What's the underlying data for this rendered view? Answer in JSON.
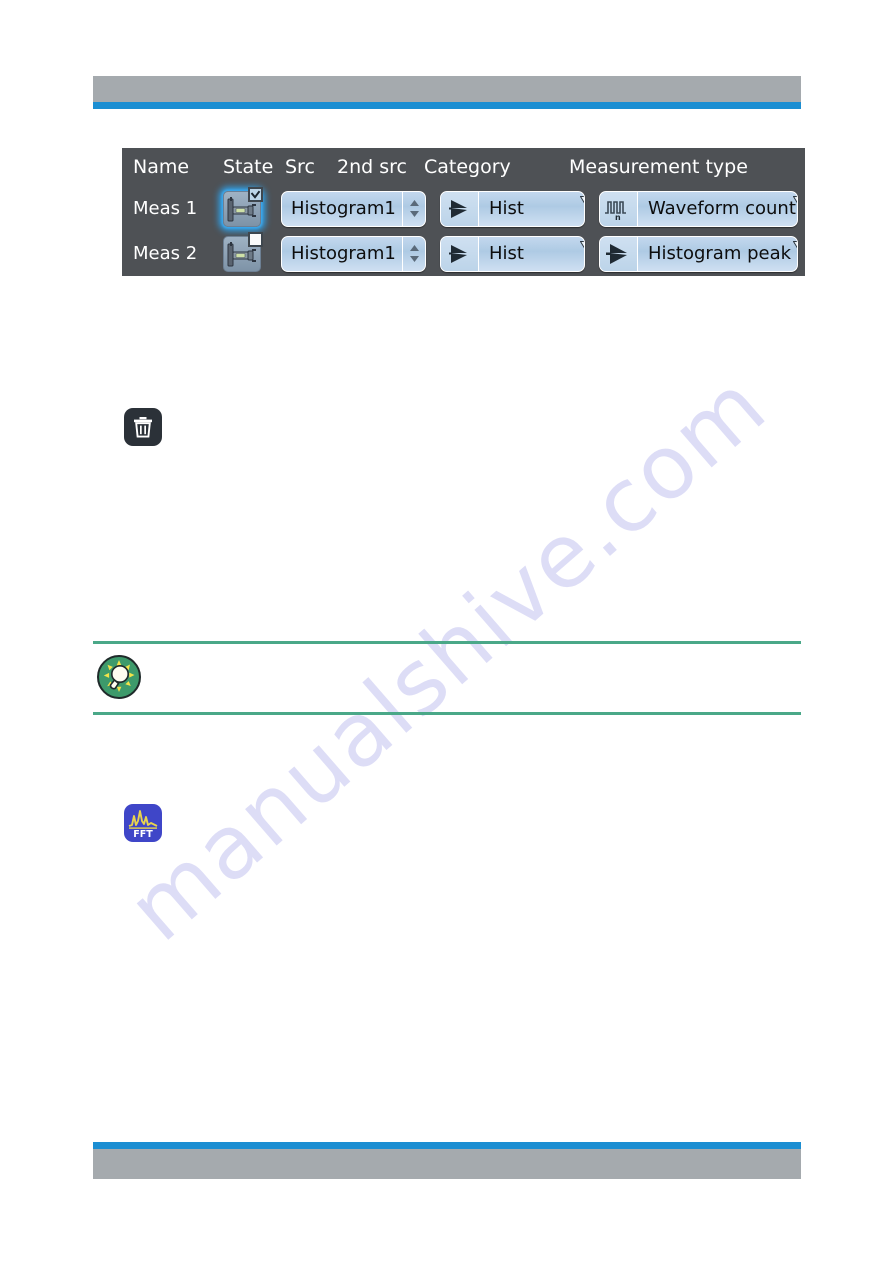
{
  "document": {
    "watermark": "manualshive.com"
  },
  "header": {
    "bar_color": "#a5aaae",
    "rule_color": "#1b8ed2"
  },
  "footer": {
    "bar_color": "#a5aaae",
    "rule_color": "#1b8ed2"
  },
  "measurement_table": {
    "columns": [
      {
        "key": "name",
        "label": "Name"
      },
      {
        "key": "state",
        "label": "State"
      },
      {
        "key": "src",
        "label": "Src"
      },
      {
        "key": "src2",
        "label": "2nd src"
      },
      {
        "key": "category",
        "label": "Category"
      },
      {
        "key": "type",
        "label": "Measurement type"
      }
    ],
    "panel_color": "#4e5155",
    "field_color": "#aecae4",
    "highlight_color": "#2fa4ef",
    "rows": [
      {
        "name": "Meas 1",
        "state": {
          "icon": "caliper-icon",
          "checked": true,
          "highlighted": true
        },
        "src": {
          "value": "Histogram1",
          "spinner_icon": "spinner-updown-icon"
        },
        "category": {
          "value": "Hist",
          "icon": "histogram-peak-icon",
          "dropdown_icon": "corner-triangle-icon"
        },
        "type": {
          "value": "Waveform count",
          "icon": "waveform-count-icon",
          "dropdown_icon": "corner-triangle-icon"
        }
      },
      {
        "name": "Meas 2",
        "state": {
          "icon": "caliper-icon",
          "checked": false,
          "highlighted": false
        },
        "src": {
          "value": "Histogram1",
          "spinner_icon": "spinner-updown-icon"
        },
        "category": {
          "value": "Hist",
          "icon": "histogram-peak-icon",
          "dropdown_icon": "corner-triangle-icon"
        },
        "type": {
          "value": "Histogram peak",
          "icon": "histogram-peak-icon",
          "dropdown_icon": "corner-triangle-icon"
        }
      }
    ]
  },
  "inline_icons": {
    "trash": {
      "name": "delete-icon",
      "background": "#2b3138"
    },
    "fft": {
      "name": "fft-icon",
      "background": "#3f46c8",
      "curve_color": "#e8d44d",
      "label": "FFT"
    }
  },
  "tip_callout": {
    "icon": "tip-lightbulb-icon",
    "rule_color": "#4aa888",
    "circle_color": "#3d9a6b",
    "bulb_color": "#f2e34a"
  }
}
